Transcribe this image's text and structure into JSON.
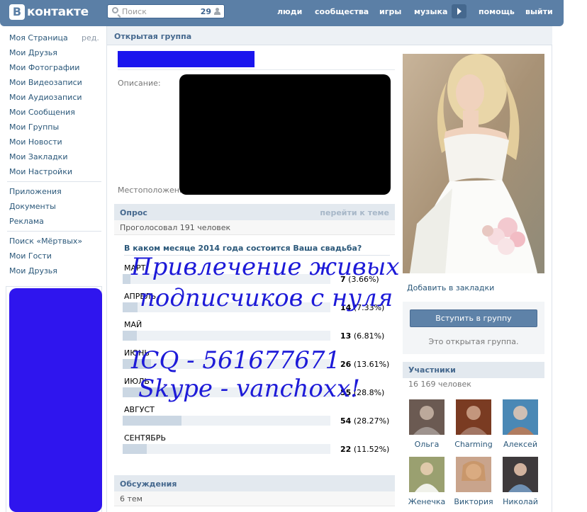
{
  "header": {
    "logo_letter": "В",
    "logo_text": "контакте",
    "search_placeholder": "Поиск",
    "search_count": "29",
    "nav": [
      "люди",
      "сообщества",
      "игры",
      "музыка",
      "помощь",
      "выйти"
    ]
  },
  "sidebar": {
    "edit_label": "ред.",
    "group1": [
      "Моя Страница",
      "Мои Друзья",
      "Мои Фотографии",
      "Мои Видеозаписи",
      "Мои Аудиозаписи",
      "Мои Сообщения",
      "Мои Группы",
      "Мои Новости",
      "Мои Закладки",
      "Мои Настройки"
    ],
    "group2": [
      "Приложения",
      "Документы",
      "Реклама"
    ],
    "group3": [
      "Поиск «Мёртвых»",
      "Мои Гости",
      "Мои Друзья"
    ]
  },
  "main": {
    "page_title": "Открытая группа",
    "description_label": "Описание:",
    "location_label": "Местоположение:"
  },
  "poll": {
    "title": "Опрос",
    "goto_label": "перейти к теме",
    "voted": "Проголосовал 191 человек",
    "question": "В каком месяце 2014 года состоится Ваша свадьба?",
    "options": [
      {
        "label": "МАРТ",
        "count": "7",
        "pct": "(3.66%)",
        "fraction": 0.0366
      },
      {
        "label": "АПРЕЛЬ",
        "count": "14",
        "pct": "(7.33%)",
        "fraction": 0.0733
      },
      {
        "label": "МАЙ",
        "count": "13",
        "pct": "(6.81%)",
        "fraction": 0.0681
      },
      {
        "label": "ИЮНЬ",
        "count": "26",
        "pct": "(13.61%)",
        "fraction": 0.1361
      },
      {
        "label": "ИЮЛЬ",
        "count": "55",
        "pct": "(28.8%)",
        "fraction": 0.288
      },
      {
        "label": "АВГУСТ",
        "count": "54",
        "pct": "(28.27%)",
        "fraction": 0.2827
      },
      {
        "label": "СЕНТЯБРЬ",
        "count": "22",
        "pct": "(11.52%)",
        "fraction": 0.1152
      }
    ]
  },
  "discussions": {
    "title": "Обсуждения",
    "count": "6 тем"
  },
  "overlay": {
    "line1": "Привлечение живых",
    "line2": "подписчиков с нуля",
    "line3": "ICQ - 561677671",
    "line4": "Skype - vanchoxx!"
  },
  "right": {
    "bookmark_link": "Добавить в закладки",
    "join_button": "Вступить в группу",
    "open_group": "Это открытая группа.",
    "members_title": "Участники",
    "members_count": "16 169 человек",
    "members": [
      {
        "name": "Ольга",
        "color": "#6b5a52"
      },
      {
        "name": "Charming",
        "color": "#7a3b22"
      },
      {
        "name": "Алексей",
        "color": "#4a88b5"
      },
      {
        "name": "Женечка",
        "color": "#9aa070"
      },
      {
        "name": "Виктория",
        "color": "#c9a48c"
      },
      {
        "name": "Николай",
        "color": "#3e3a3c"
      }
    ]
  },
  "colors": {
    "header": "#5b7fa6",
    "link": "#2b587a",
    "ad_block": "#2f15ee",
    "redaction": "#000000",
    "overlay_text": "#1d1ad8"
  }
}
